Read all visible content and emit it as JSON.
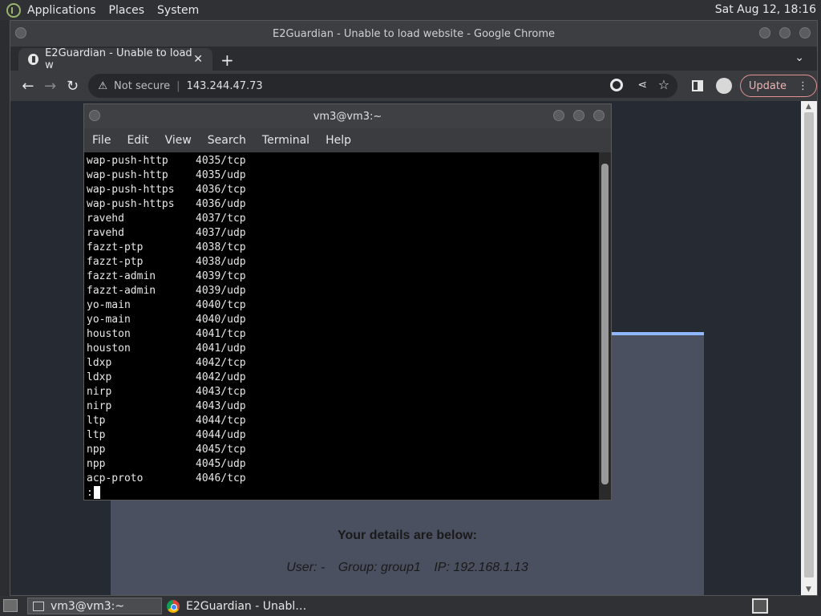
{
  "top_panel": {
    "menus": [
      "Applications",
      "Places",
      "System"
    ],
    "clock": "Sat Aug 12, 18:16"
  },
  "chrome": {
    "window_title": "E2Guardian - Unable to load website - Google Chrome",
    "tab_title": "E2Guardian - Unable to load w",
    "security_label": "Not secure",
    "url": "143.244.47.73",
    "update_label": "Update"
  },
  "page": {
    "details_title": "Your details are below:",
    "user_label": "User: -",
    "group_label": "Group: group1",
    "ip_label": "IP: 192.168.1.13"
  },
  "terminal": {
    "title": "vm3@vm3:~",
    "menu": [
      "File",
      "Edit",
      "View",
      "Search",
      "Terminal",
      "Help"
    ],
    "lines": [
      [
        "wap-push-http",
        "4035/tcp"
      ],
      [
        "wap-push-http",
        "4035/udp"
      ],
      [
        "wap-push-https",
        "4036/tcp"
      ],
      [
        "wap-push-https",
        "4036/udp"
      ],
      [
        "ravehd",
        "4037/tcp"
      ],
      [
        "ravehd",
        "4037/udp"
      ],
      [
        "fazzt-ptp",
        "4038/tcp"
      ],
      [
        "fazzt-ptp",
        "4038/udp"
      ],
      [
        "fazzt-admin",
        "4039/tcp"
      ],
      [
        "fazzt-admin",
        "4039/udp"
      ],
      [
        "yo-main",
        "4040/tcp"
      ],
      [
        "yo-main",
        "4040/udp"
      ],
      [
        "houston",
        "4041/tcp"
      ],
      [
        "houston",
        "4041/udp"
      ],
      [
        "ldxp",
        "4042/tcp"
      ],
      [
        "ldxp",
        "4042/udp"
      ],
      [
        "nirp",
        "4043/tcp"
      ],
      [
        "nirp",
        "4043/udp"
      ],
      [
        "ltp",
        "4044/tcp"
      ],
      [
        "ltp",
        "4044/udp"
      ],
      [
        "npp",
        "4045/tcp"
      ],
      [
        "npp",
        "4045/udp"
      ],
      [
        "acp-proto",
        "4046/tcp"
      ]
    ],
    "prompt": ":"
  },
  "taskbar": {
    "items": [
      "vm3@vm3:~",
      "E2Guardian - Unabl…"
    ]
  }
}
